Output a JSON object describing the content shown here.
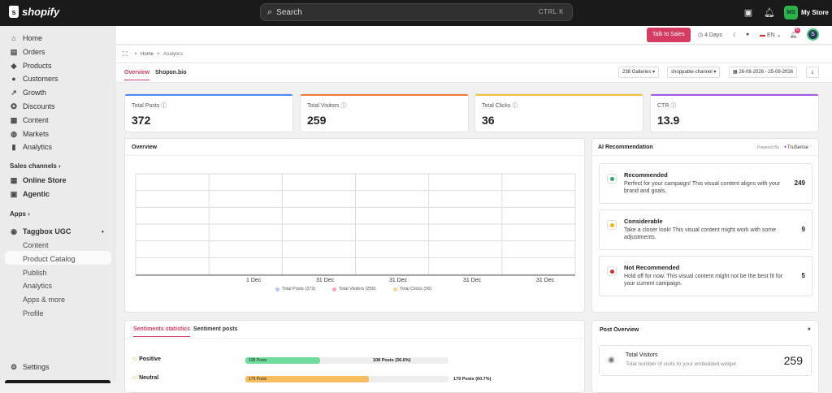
{
  "topbar": {
    "logo": "shopify",
    "search_placeholder": "Search",
    "search_shortcut": "CTRL  K",
    "store_initials": "MS",
    "store_name": "My Store"
  },
  "sidebar": {
    "items": [
      {
        "label": "Home",
        "icon": "home-icon"
      },
      {
        "label": "Orders",
        "icon": "orders-icon"
      },
      {
        "label": "Products",
        "icon": "tag-icon"
      },
      {
        "label": "Customers",
        "icon": "person-icon"
      },
      {
        "label": "Growth",
        "icon": "growth-icon"
      },
      {
        "label": "Discounts",
        "icon": "discount-icon"
      },
      {
        "label": "Content",
        "icon": "content-icon"
      },
      {
        "label": "Markets",
        "icon": "globe-icon"
      },
      {
        "label": "Analytics",
        "icon": "chart-icon"
      }
    ],
    "sales_channels_label": "Sales channels",
    "channels": [
      {
        "label": "Online Store",
        "icon": "store-icon"
      },
      {
        "label": "Agentic",
        "icon": "agentic-icon"
      }
    ],
    "apps_label": "Apps",
    "app_name": "Taggbox UGC",
    "app_subitems": [
      "Content",
      "Product Catalog",
      "Publish",
      "Analytics",
      "Apps & more",
      "Profile"
    ],
    "settings_label": "Settings"
  },
  "header": {
    "talk_label": "Talk to Sales",
    "days_label": "4 Days",
    "lang_label": "EN",
    "notif_count": "6",
    "avatar_letter": "S",
    "avatar_pct": "98%"
  },
  "breadcrumb": {
    "home": "Home",
    "current": "Analytics"
  },
  "tabs": [
    {
      "label": "Overview",
      "active": true
    },
    {
      "label": "Shopon.bio",
      "active": false
    }
  ],
  "controls": {
    "galleries": "238 Galleries ▾",
    "channel": "shoppable-channel ▾",
    "date_range": "26-08-2026 - 25-09-2026"
  },
  "stats": [
    {
      "label": "Total Posts",
      "value": "372",
      "color": "#4c8bf5"
    },
    {
      "label": "Total Visitors",
      "value": "259",
      "color": "#f07a3c"
    },
    {
      "label": "Total Clicks",
      "value": "36",
      "color": "#f5c342"
    },
    {
      "label": "CTR",
      "value": "13.9",
      "color": "#a259e6"
    }
  ],
  "overview": {
    "title": "Overview",
    "x_ticks": [
      "1 Dec",
      "31 Dec",
      "31 Dec",
      "31 Dec",
      "31 Dec"
    ],
    "legend": [
      {
        "label": "Total Posts (372)",
        "color": "#b9c6f0"
      },
      {
        "label": "Total Visitors (259)",
        "color": "#f4a6bf"
      },
      {
        "label": "Total Clicks (36)",
        "color": "#f8d29b"
      }
    ]
  },
  "ai": {
    "title": "AI Recommendation",
    "powered": "Powered By",
    "brand": "TruSense",
    "items": [
      {
        "title": "Recommended",
        "desc": "Perfect for your campaign! This visual content aligns with your brand and goals.",
        "count": "249",
        "color": "#27ae60"
      },
      {
        "title": "Considerable",
        "desc": "Take a closer look! This visual content might work with some adjustments.",
        "count": "9",
        "color": "#f2b705"
      },
      {
        "title": "Not Recommended",
        "desc": "Hold off for now. This visual content might not be the best fit for your current campaign.",
        "count": "5",
        "color": "#d63031"
      }
    ]
  },
  "sentiments": {
    "tabs": [
      {
        "label": "Sentiments statistics",
        "active": true
      },
      {
        "label": "Sentiment posts",
        "active": false
      }
    ],
    "rows": [
      {
        "label": "Positive",
        "bar_label": "108 Posts",
        "result": "108 Posts (36.6%)",
        "pct": 0.366,
        "color": "#6fdc9c"
      },
      {
        "label": "Neutral",
        "bar_label": "179 Posts",
        "result": "179 Posts (60.7%)",
        "pct": 0.607,
        "color": "#f6bd60"
      }
    ]
  },
  "post_overview": {
    "title": "Post Overview",
    "card_title": "Total Visitors",
    "card_desc": "Total number of visits to your embedded widget.",
    "card_value": "259"
  }
}
